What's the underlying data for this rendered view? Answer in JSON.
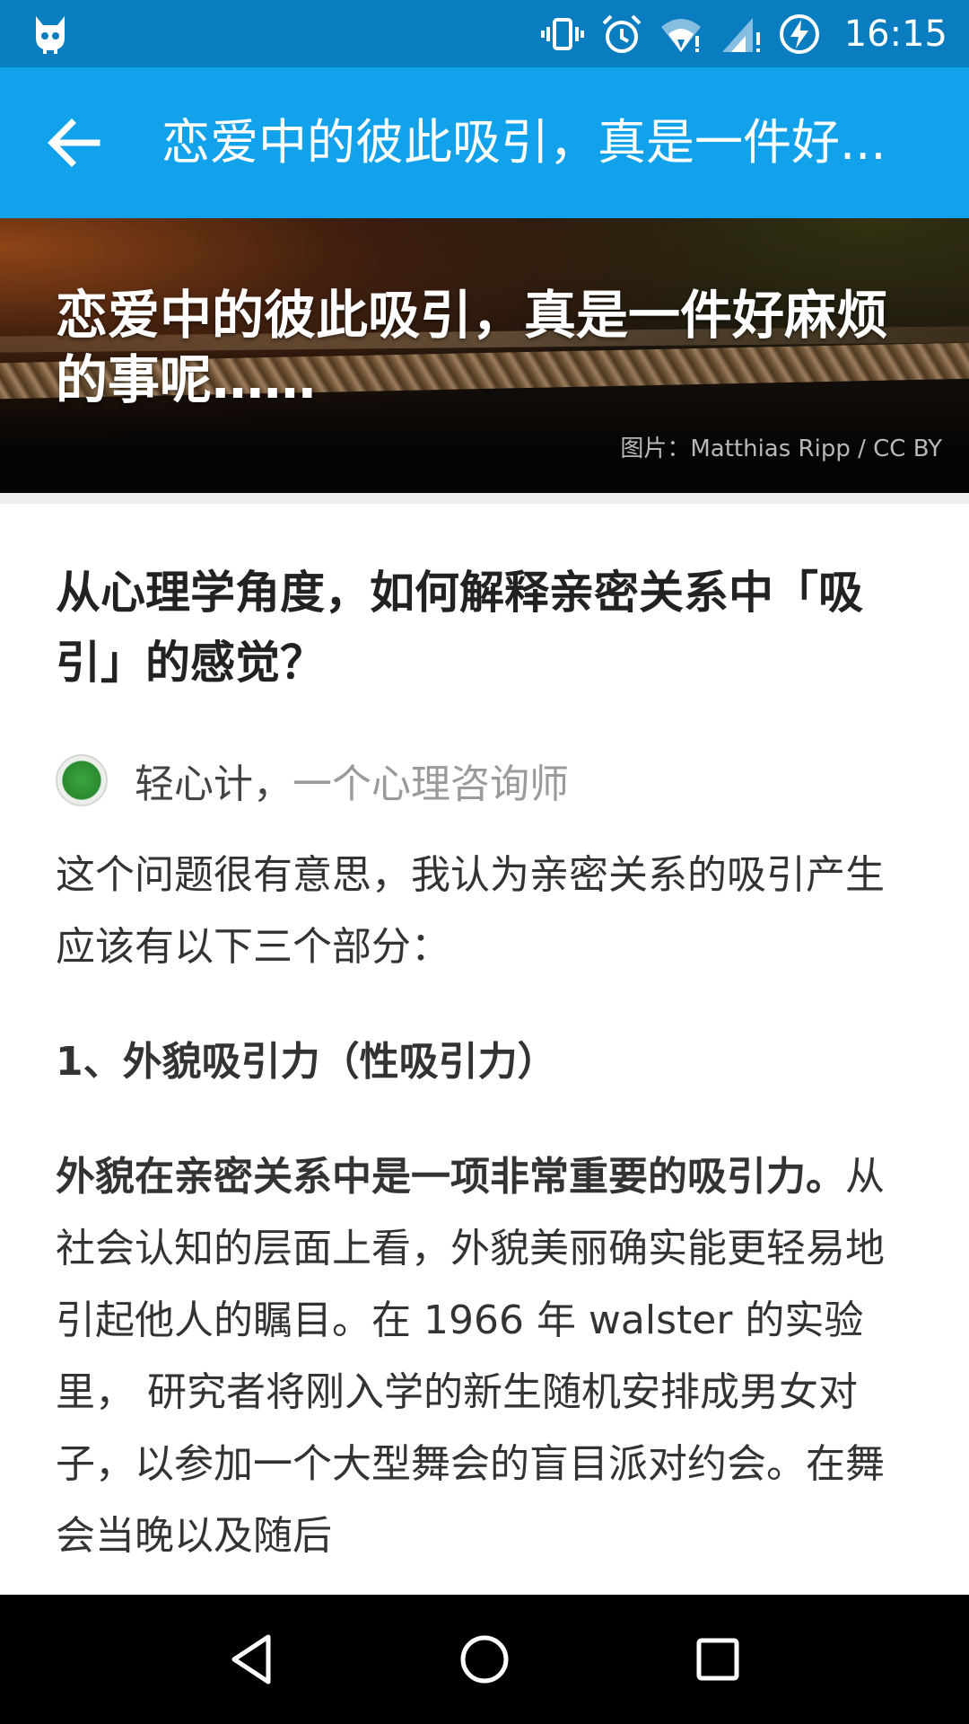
{
  "status_bar": {
    "time": "16:15",
    "icons": [
      "cat-logo-icon",
      "vibrate-icon",
      "alarm-icon",
      "wifi-icon",
      "cell-signal-icon",
      "battery-charging-icon"
    ]
  },
  "app_bar": {
    "back_icon": "arrow-left-icon",
    "title": "恋爱中的彼此吸引，真是一件好..."
  },
  "hero": {
    "title": "恋爱中的彼此吸引，真是一件好麻烦的事呢……",
    "credit": "图片：Matthias Ripp / CC BY"
  },
  "article": {
    "question": "从心理学角度，如何解释亲密关系中「吸引」的感觉？",
    "author_name": "轻心计，",
    "author_bio": "一个心理咨询师",
    "intro": "这个问题很有意思，我认为亲密关系的吸引产生应该有以下三个部分：",
    "section_heading": "1、外貌吸引力（性吸引力）",
    "para_bold": "外貌在亲密关系中是一项非常重要的吸引力。",
    "para_text": "从社会认知的层面上看，外貌美丽确实能更轻易地引起他人的瞩目。在 1966 年 walster 的实验里， 研究者将刚入学的新生随机安排成男女对子，以参加一个大型舞会的盲目派对约会。在舞会当晚以及随后"
  },
  "nav_bar": {
    "back": "nav-back-icon",
    "home": "nav-home-icon",
    "recents": "nav-recents-icon"
  }
}
